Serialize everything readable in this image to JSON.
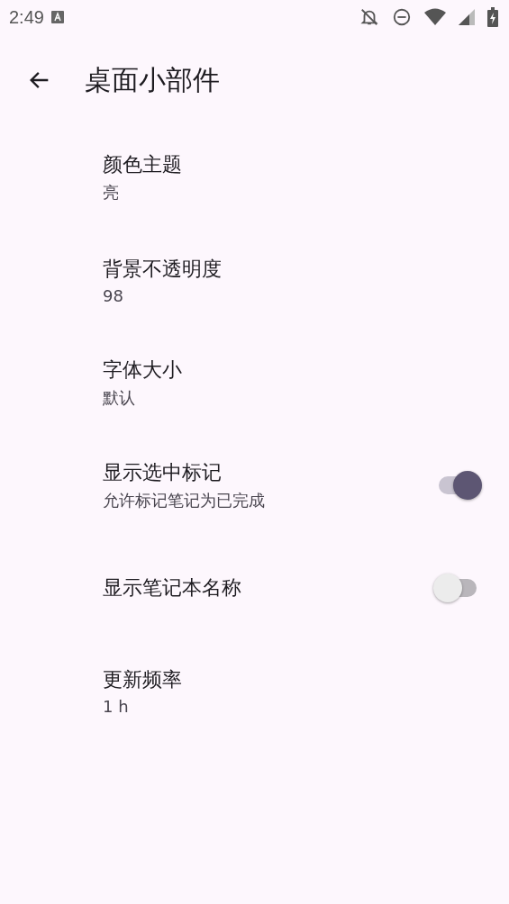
{
  "status_bar": {
    "time": "2:49"
  },
  "app_bar": {
    "title": "桌面小部件"
  },
  "settings": [
    {
      "kind": "value",
      "title": "颜色主题",
      "summary": "亮"
    },
    {
      "kind": "value",
      "title": "背景不透明度",
      "summary": "98"
    },
    {
      "kind": "value",
      "title": "字体大小",
      "summary": "默认"
    },
    {
      "kind": "switch",
      "title": "显示选中标记",
      "summary": "允许标记笔记为已完成",
      "on": true
    },
    {
      "kind": "switch",
      "title": "显示笔记本名称",
      "on": false
    },
    {
      "kind": "value",
      "title": "更新频率",
      "summary": "1 h"
    }
  ]
}
